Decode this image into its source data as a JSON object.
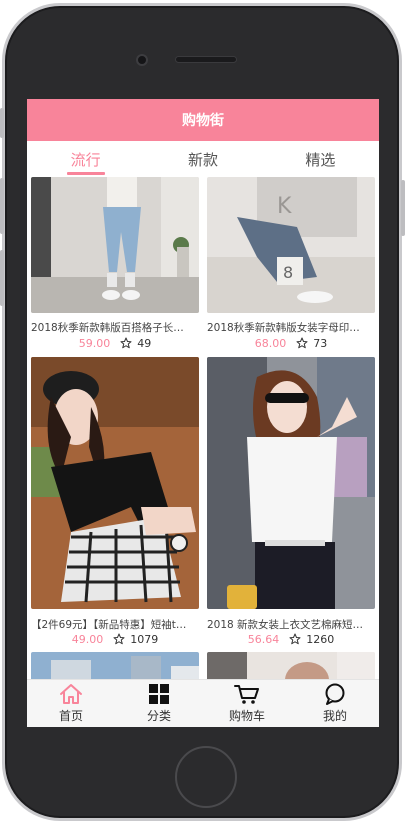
{
  "navbar": {
    "title": "购物街"
  },
  "tabs": [
    {
      "label": "流行",
      "active": true
    },
    {
      "label": "新款",
      "active": false
    },
    {
      "label": "精选",
      "active": false
    }
  ],
  "goods": [
    {
      "title": "2018秋季新款韩版百搭格子长…",
      "price": "59.00",
      "favorites": "49"
    },
    {
      "title": "2018秋季新款韩版女装字母印…",
      "price": "68.00",
      "favorites": "73"
    },
    {
      "title": "【2件69元】【新品特惠】短袖t…",
      "price": "49.00",
      "favorites": "1079"
    },
    {
      "title": "2018 新款女装上衣文艺棉麻短…",
      "price": "56.64",
      "favorites": "1260"
    }
  ],
  "tabbar": [
    {
      "label": "首页",
      "icon": "home-icon",
      "active": true
    },
    {
      "label": "分类",
      "icon": "category-grid-icon",
      "active": false
    },
    {
      "label": "购物车",
      "icon": "cart-icon",
      "active": false
    },
    {
      "label": "我的",
      "icon": "profile-chat-icon",
      "active": false
    }
  ],
  "colors": {
    "accent": "#f8849a",
    "tabbar_bg": "#f6f6f6"
  }
}
